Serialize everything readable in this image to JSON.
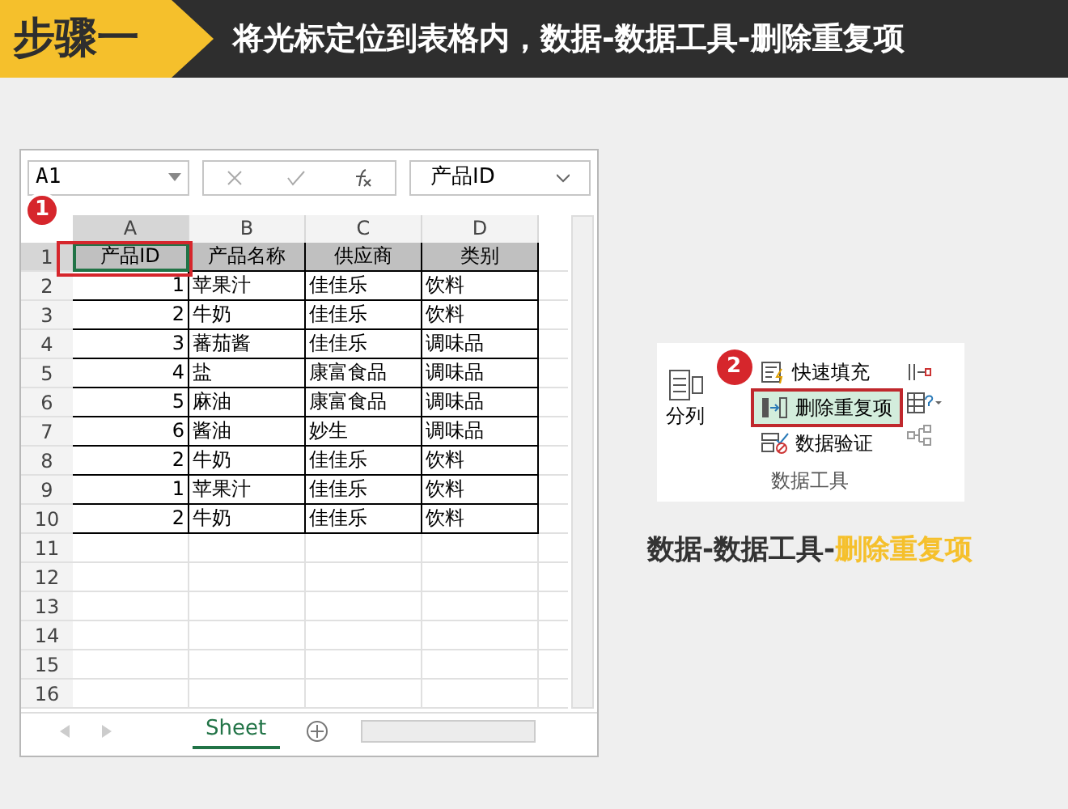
{
  "step": {
    "label": "步骤一",
    "instruction": "将光标定位到表格内，数据-数据工具-删除重复项"
  },
  "excel": {
    "name_box": "A1",
    "formula": "产品ID",
    "callout": "1",
    "columns": [
      "A",
      "B",
      "C",
      "D"
    ],
    "rows": [
      {
        "header": "1",
        "kind": "heading",
        "cells": [
          {
            "text": "产品ID",
            "selected": true
          },
          {
            "text": "产品名称",
            "selected": false
          },
          {
            "text": "供应商",
            "selected": false
          },
          {
            "text": "类别",
            "selected": false
          }
        ]
      },
      {
        "header": "2",
        "kind": "data",
        "cells": [
          {
            "text": "1",
            "selected": false
          },
          {
            "text": "苹果汁",
            "selected": false
          },
          {
            "text": "佳佳乐",
            "selected": false
          },
          {
            "text": "饮料",
            "selected": false
          }
        ]
      },
      {
        "header": "3",
        "kind": "data",
        "cells": [
          {
            "text": "2",
            "selected": false
          },
          {
            "text": "牛奶",
            "selected": false
          },
          {
            "text": "佳佳乐",
            "selected": false
          },
          {
            "text": "饮料",
            "selected": false
          }
        ]
      },
      {
        "header": "4",
        "kind": "data",
        "cells": [
          {
            "text": "3",
            "selected": false
          },
          {
            "text": "蕃茄酱",
            "selected": false
          },
          {
            "text": "佳佳乐",
            "selected": false
          },
          {
            "text": "调味品",
            "selected": false
          }
        ]
      },
      {
        "header": "5",
        "kind": "data",
        "cells": [
          {
            "text": "4",
            "selected": false
          },
          {
            "text": "盐",
            "selected": false
          },
          {
            "text": "康富食品",
            "selected": false
          },
          {
            "text": "调味品",
            "selected": false
          }
        ]
      },
      {
        "header": "6",
        "kind": "data",
        "cells": [
          {
            "text": "5",
            "selected": false
          },
          {
            "text": "麻油",
            "selected": false
          },
          {
            "text": "康富食品",
            "selected": false
          },
          {
            "text": "调味品",
            "selected": false
          }
        ]
      },
      {
        "header": "7",
        "kind": "data",
        "cells": [
          {
            "text": "6",
            "selected": false
          },
          {
            "text": "酱油",
            "selected": false
          },
          {
            "text": "妙生",
            "selected": false
          },
          {
            "text": "调味品",
            "selected": false
          }
        ]
      },
      {
        "header": "8",
        "kind": "data",
        "cells": [
          {
            "text": "2",
            "selected": false
          },
          {
            "text": "牛奶",
            "selected": false
          },
          {
            "text": "佳佳乐",
            "selected": false
          },
          {
            "text": "饮料",
            "selected": false
          }
        ]
      },
      {
        "header": "9",
        "kind": "data",
        "cells": [
          {
            "text": "1",
            "selected": false
          },
          {
            "text": "苹果汁",
            "selected": false
          },
          {
            "text": "佳佳乐",
            "selected": false
          },
          {
            "text": "饮料",
            "selected": false
          }
        ]
      },
      {
        "header": "10",
        "kind": "data",
        "cells": [
          {
            "text": "2",
            "selected": false
          },
          {
            "text": "牛奶",
            "selected": false
          },
          {
            "text": "佳佳乐",
            "selected": false
          },
          {
            "text": "饮料",
            "selected": false
          }
        ]
      }
    ],
    "empty_rows": [
      "11",
      "12",
      "13",
      "14",
      "15",
      "16"
    ],
    "sheet_tabs": [
      {
        "label": "Sheet",
        "selected": true
      }
    ]
  },
  "ribbon": {
    "callout": "2",
    "split_button": "分列",
    "commands": [
      {
        "label": "快速填充",
        "selected": false
      },
      {
        "label": "删除重复项",
        "selected": true
      },
      {
        "label": "数据验证",
        "selected": false
      }
    ],
    "group_label": "数据工具"
  },
  "caption": {
    "path": "数据-数据工具-",
    "target": "删除重复项"
  }
}
